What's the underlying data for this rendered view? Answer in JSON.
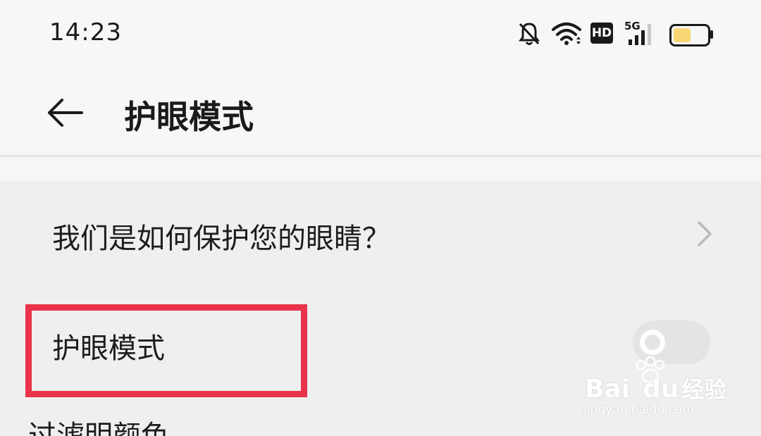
{
  "status_bar": {
    "time": "14:23",
    "network_label": "5G",
    "hd_label": "HD",
    "icons": [
      "bell-muted-icon",
      "wifi-icon",
      "hd-icon",
      "signal-5g-icon",
      "battery-icon"
    ],
    "battery_color": "#f7d774"
  },
  "header": {
    "back_icon": "arrow-left-icon",
    "title": "护眼模式"
  },
  "settings": {
    "items": [
      {
        "label": "我们是如何保护您的眼睛？",
        "type": "link"
      },
      {
        "label": "护眼模式",
        "type": "toggle",
        "enabled": false
      },
      {
        "label": "过滤明颜色",
        "type": "partial"
      }
    ]
  },
  "annotation": {
    "highlight_color": "#e8334a"
  },
  "watermark": {
    "brand_prefix": "Bai",
    "brand_suffix": "du",
    "brand_cn": "经验",
    "url": "jingyan.baidu.com"
  }
}
